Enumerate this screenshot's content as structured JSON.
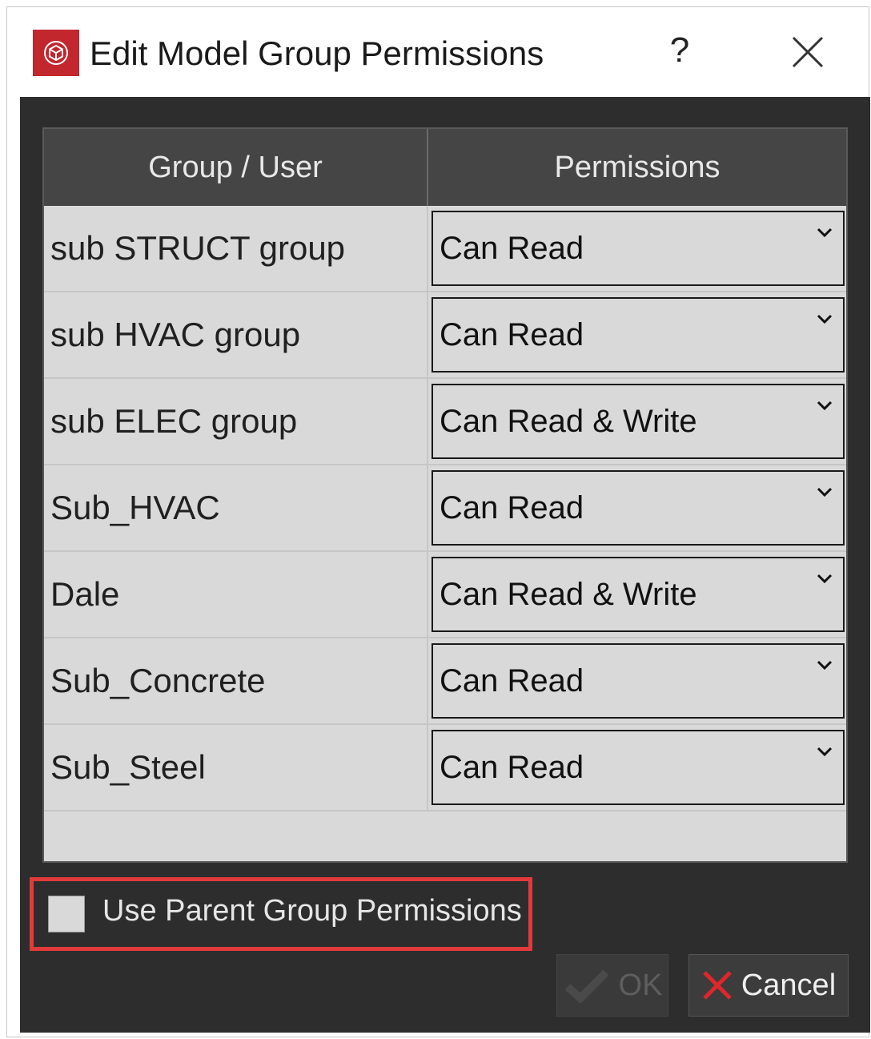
{
  "window": {
    "title": "Edit Model Group Permissions",
    "help_label": "?",
    "brand_color": "#c1272d"
  },
  "table": {
    "headers": [
      "Group / User",
      "Permissions"
    ],
    "rows": [
      {
        "name": "sub STRUCT group",
        "permission": "Can Read"
      },
      {
        "name": "sub HVAC group",
        "permission": "Can Read"
      },
      {
        "name": "sub ELEC group",
        "permission": "Can Read & Write"
      },
      {
        "name": "Sub_HVAC",
        "permission": "Can Read"
      },
      {
        "name": "Dale",
        "permission": "Can Read & Write"
      },
      {
        "name": "Sub_Concrete",
        "permission": "Can Read"
      },
      {
        "name": "Sub_Steel",
        "permission": "Can Read"
      }
    ]
  },
  "options": {
    "use_parent_label": "Use Parent Group Permissions",
    "use_parent_checked": false,
    "highlight_color": "#e23a3a"
  },
  "buttons": {
    "ok_label": "OK",
    "ok_enabled": false,
    "cancel_label": "Cancel",
    "cancel_icon_color": "#e0262b"
  }
}
